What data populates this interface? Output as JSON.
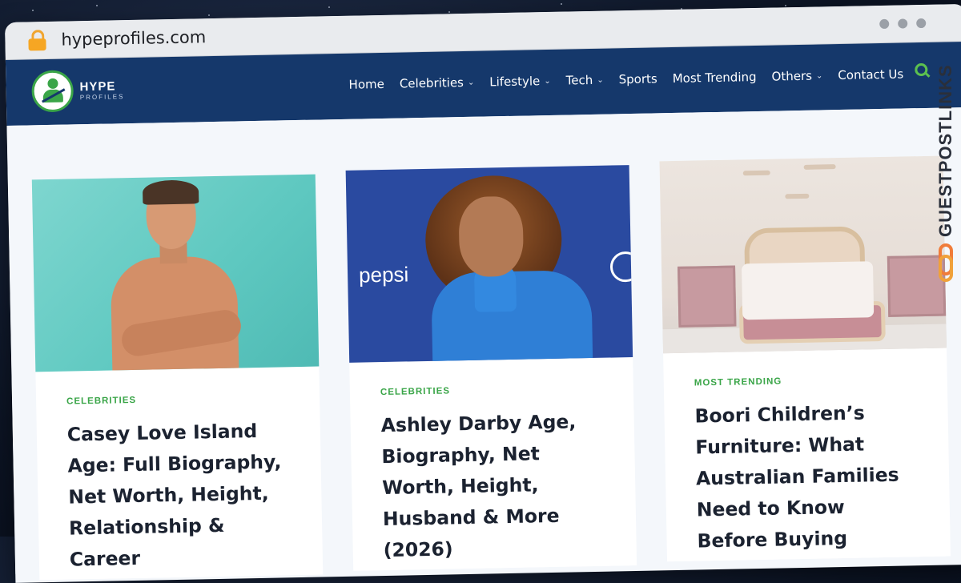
{
  "browser": {
    "url": "hypeprofiles.com"
  },
  "site": {
    "logo_line1": "HYPE",
    "logo_line2": "PROFILES",
    "nav": [
      {
        "label": "Home",
        "has_dropdown": false
      },
      {
        "label": "Celebrities",
        "has_dropdown": true
      },
      {
        "label": "Lifestyle",
        "has_dropdown": true
      },
      {
        "label": "Tech",
        "has_dropdown": true
      },
      {
        "label": "Sports",
        "has_dropdown": false
      },
      {
        "label": "Most Trending",
        "has_dropdown": false
      },
      {
        "label": "Others",
        "has_dropdown": true
      },
      {
        "label": "Contact Us",
        "has_dropdown": false
      }
    ],
    "search_icon": "search-icon",
    "colors": {
      "nav_bg": "#15386b",
      "accent_green": "#3aa548",
      "page_bg": "#f4f7fb"
    }
  },
  "cards": [
    {
      "category": "CELEBRITIES",
      "title": "Casey Love Island Age: Full Biography, Net Worth, Height, Relationship & Career",
      "image": "man-photo"
    },
    {
      "category": "CELEBRITIES",
      "title": "Ashley Darby Age, Biography, Net Worth, Height, Husband & More (2026)",
      "image": "woman-photo",
      "image_text": "pepsi"
    },
    {
      "category": "MOST TRENDING",
      "title": "Boori Children’s Furniture: What Australian Families Need to Know Before Buying",
      "image": "bedroom-photo"
    }
  ],
  "watermark": {
    "text": "GUESTPOSTLINKS"
  }
}
